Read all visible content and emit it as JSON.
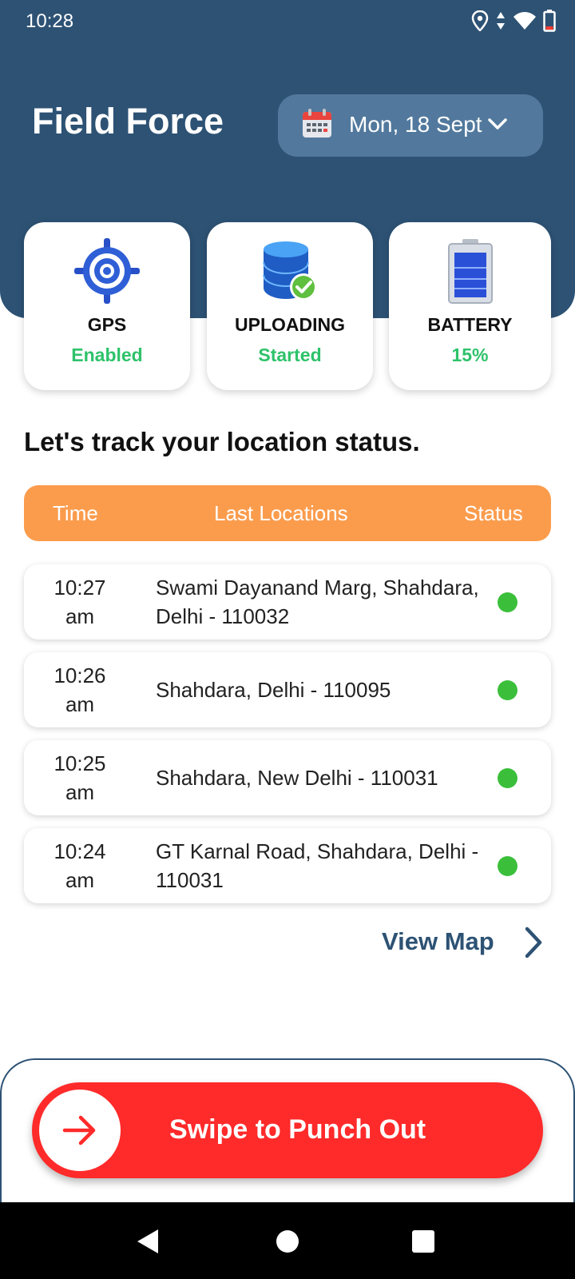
{
  "status_bar": {
    "time": "10:28",
    "icons": [
      "location-icon",
      "data-arrows-icon",
      "wifi-icon",
      "battery-icon"
    ]
  },
  "header": {
    "title": "Field Force",
    "date_label": "Mon, 18 Sept",
    "icons": [
      "calendar-icon",
      "chevron-down-icon"
    ]
  },
  "status_cards": [
    {
      "icon": "gps-target-icon",
      "label": "GPS",
      "value": "Enabled"
    },
    {
      "icon": "database-upload-icon",
      "label": "UPLOADING",
      "value": "Started"
    },
    {
      "icon": "battery-level-icon",
      "label": "BATTERY",
      "value": "15%"
    }
  ],
  "section_title": "Let's track your location status.",
  "table": {
    "columns": [
      "Time",
      "Last Locations",
      "Status"
    ],
    "rows": [
      {
        "time_line1": "10:27",
        "time_line2": "am",
        "location": "Swami Dayanand Marg, Shahdara, Delhi - 110032",
        "status": "active"
      },
      {
        "time_line1": "10:26",
        "time_line2": "am",
        "location": "Shahdara, Delhi - 110095",
        "status": "active"
      },
      {
        "time_line1": "10:25",
        "time_line2": "am",
        "location": "Shahdara, New Delhi - 110031",
        "status": "active"
      },
      {
        "time_line1": "10:24",
        "time_line2": "am",
        "location": "GT Karnal Road, Shahdara, Delhi - 110031",
        "status": "active"
      }
    ]
  },
  "view_map_label": "View Map",
  "swipe_button": {
    "label": "Swipe to Punch Out",
    "icon": "arrow-right-icon"
  },
  "nav_bar": {
    "icons": [
      "back-icon",
      "home-icon",
      "recents-icon"
    ]
  },
  "colors": {
    "header_bg": "#2d5274",
    "date_pill_bg": "#52799d",
    "accent_orange": "#fb9c4d",
    "success_green": "#2ec26a",
    "status_dot": "#3bbf3b",
    "danger_red": "#ff2a2a"
  }
}
